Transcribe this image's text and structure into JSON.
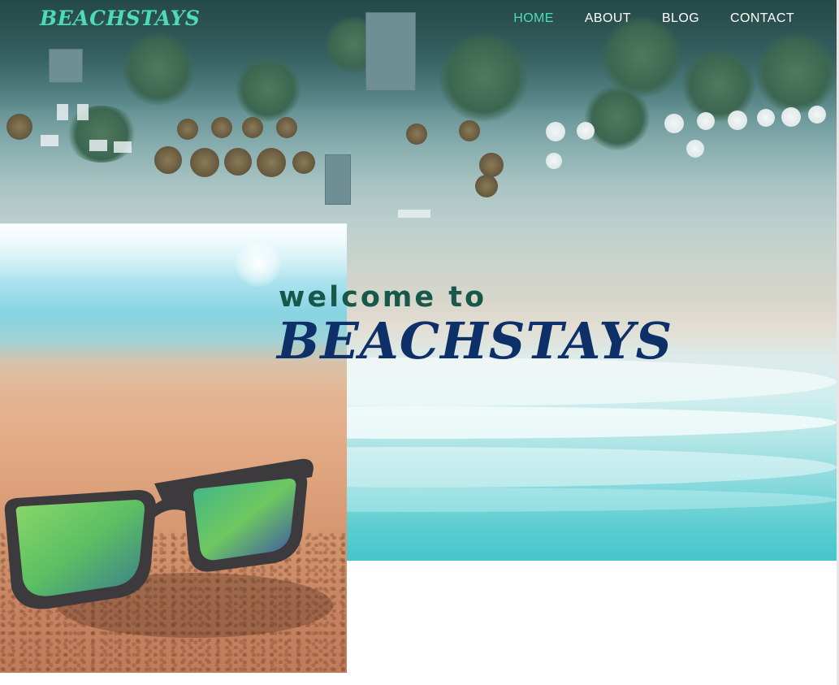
{
  "nav": {
    "logo": "BEACHSTAYS",
    "items": [
      {
        "label": "HOME",
        "active": true
      },
      {
        "label": "ABOUT",
        "active": false
      },
      {
        "label": "BLOG",
        "active": false
      },
      {
        "label": "CONTACT",
        "active": false
      }
    ]
  },
  "hero": {
    "welcome": "welcome to",
    "brand": "BEACHSTAYS",
    "background": "aerial-beach-photo"
  },
  "photo": {
    "subject": "sunglasses-on-sand-photo"
  },
  "colors": {
    "logo": "#4ddbb4",
    "nav_active": "#4ddbb4",
    "nav_inactive": "#ffffff",
    "welcome": "#17584a",
    "brand": "#0e3069"
  }
}
